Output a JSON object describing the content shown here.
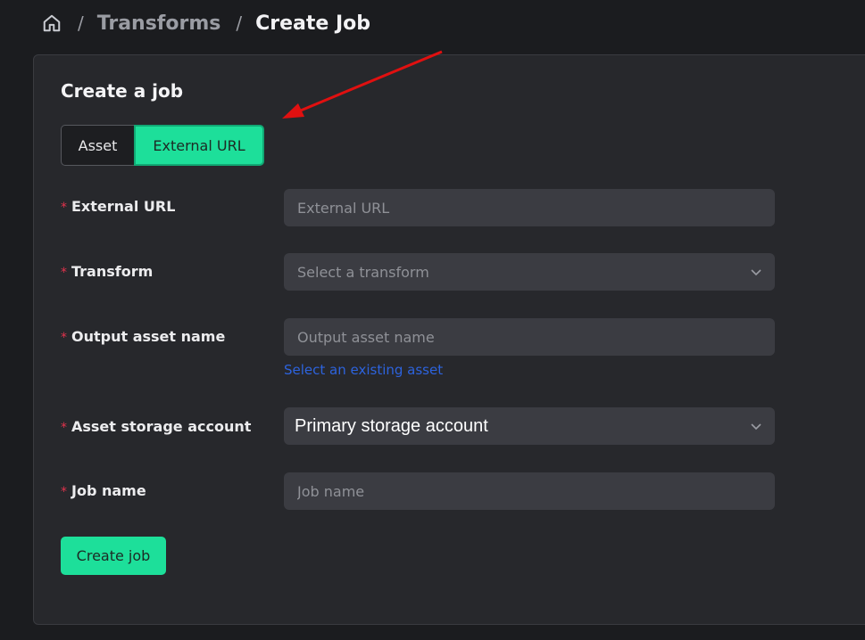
{
  "breadcrumb": {
    "home_icon": "home-icon",
    "separator": "/",
    "items": [
      {
        "label": "Transforms"
      },
      {
        "label": "Create Job"
      }
    ]
  },
  "card": {
    "title": "Create a job",
    "source_tabs": [
      {
        "label": "Asset",
        "selected": false
      },
      {
        "label": "External URL",
        "selected": true
      }
    ],
    "required_marker": "*",
    "fields": {
      "external_url": {
        "label": "External URL",
        "placeholder": "External URL"
      },
      "transform": {
        "label": "Transform",
        "placeholder": "Select a transform"
      },
      "output_asset_name": {
        "label": "Output asset name",
        "placeholder": "Output asset name",
        "link": "Select an existing asset"
      },
      "asset_storage_account": {
        "label": "Asset storage account",
        "value": "Primary storage account"
      },
      "job_name": {
        "label": "Job name",
        "placeholder": "Job name"
      }
    },
    "create_button": "Create job"
  },
  "colors": {
    "accent": "#1ddf9a",
    "required": "#e2334d",
    "link": "#2d63dd",
    "annotation_arrow": "#e01010"
  }
}
